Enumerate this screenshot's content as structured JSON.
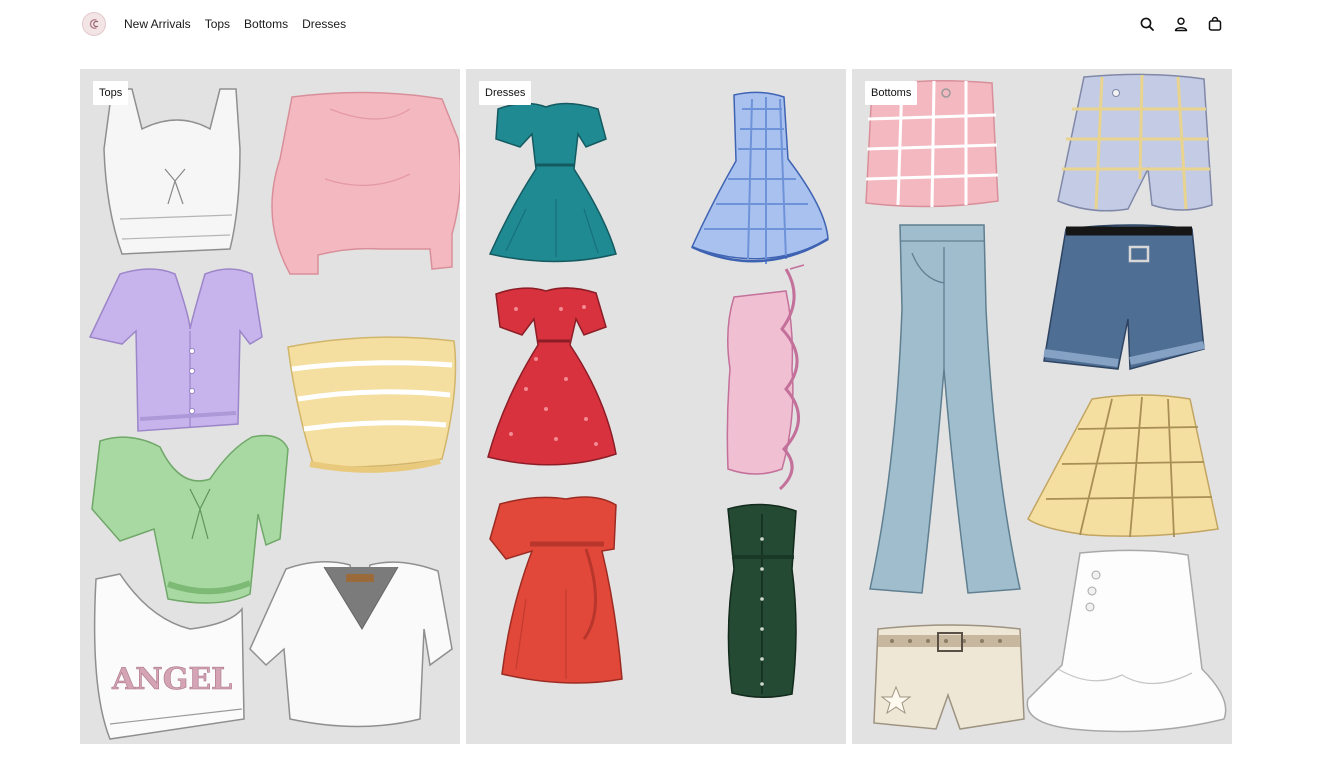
{
  "brand": {
    "logo_icon": "cc-monogram-logo"
  },
  "nav": {
    "items": [
      {
        "label": "New Arrivals"
      },
      {
        "label": "Tops"
      },
      {
        "label": "Bottoms"
      },
      {
        "label": "Dresses"
      }
    ]
  },
  "header_actions": {
    "icons": [
      "search-icon",
      "account-icon",
      "shopping-bag-icon"
    ]
  },
  "categories": [
    {
      "label": "Tops",
      "illustrations": [
        "white-bralette-top",
        "pink-off-shoulder-top",
        "lilac-cropped-cardigan",
        "yellow-striped-tube-top",
        "green-puff-sleeve-top",
        "white-one-shoulder-top",
        "white-v-neck-crop-tee"
      ]
    },
    {
      "label": "Dresses",
      "illustrations": [
        "teal-off-shoulder-dress",
        "blue-gingham-strapless-dress",
        "red-floral-puff-sleeve-dress",
        "pink-ruffle-bodycon-dress",
        "red-off-shoulder-midi-dress",
        "green-button-front-strapless-dress"
      ]
    },
    {
      "label": "Bottoms",
      "illustrations": [
        "pink-plaid-skort",
        "blue-plaid-shorts",
        "light-wash-flare-jeans",
        "denim-cuffed-shorts",
        "yellow-plaid-pleated-skirt",
        "cream-studded-belt-shorts",
        "white-ruffle-hem-skirt"
      ]
    }
  ],
  "illustration_text": {
    "angel_print": "ANGEL"
  },
  "colors": {
    "panel_bg": "#e2e2e2",
    "pink": "#f4b9c0",
    "lilac": "#c8b4ec",
    "butter": "#f4dfa0",
    "mint": "#a9d9a3",
    "teal": "#1f8a92",
    "gingham_blue": "#6f93d8",
    "floral_red": "#d9323f",
    "blush": "#f1bfd2",
    "tomato": "#e2483a",
    "forest": "#244a33",
    "denim_light": "#9fbdcc",
    "denim_dark": "#4f6e94",
    "cream": "#efe7d6"
  }
}
